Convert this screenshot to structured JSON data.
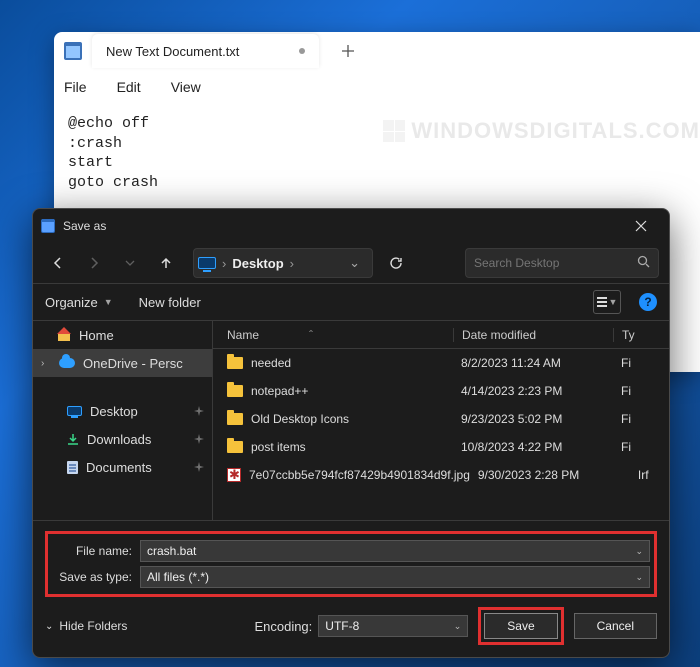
{
  "notepad": {
    "tab_title": "New Text Document.txt",
    "menu": {
      "file": "File",
      "edit": "Edit",
      "view": "View"
    },
    "content": "@echo off\n:crash\nstart\ngoto crash"
  },
  "watermark": "WINDOWSDIGITALS.COM",
  "dialog": {
    "title": "Save as",
    "breadcrumb": "Desktop",
    "search_placeholder": "Search Desktop",
    "organize": "Organize",
    "new_folder": "New folder",
    "help": "?",
    "sidebar": {
      "home": "Home",
      "onedrive": "OneDrive - Persc",
      "desktop": "Desktop",
      "downloads": "Downloads",
      "documents": "Documents"
    },
    "headers": {
      "name": "Name",
      "date": "Date modified",
      "type": "Ty"
    },
    "rows": [
      {
        "icon": "folder",
        "name": "needed",
        "date": "8/2/2023 11:24 AM",
        "type": "Fi"
      },
      {
        "icon": "folder",
        "name": "notepad++",
        "date": "4/14/2023 2:23 PM",
        "type": "Fi"
      },
      {
        "icon": "folder",
        "name": "Old Desktop Icons",
        "date": "9/23/2023 5:02 PM",
        "type": "Fi"
      },
      {
        "icon": "folder",
        "name": "post items",
        "date": "10/8/2023 4:22 PM",
        "type": "Fi"
      },
      {
        "icon": "jpg",
        "name": "7e07ccbb5e794fcf87429b4901834d9f.jpg",
        "date": "9/30/2023 2:28 PM",
        "type": "Irf"
      }
    ],
    "file_name_label": "File name:",
    "file_name_value": "crash.bat",
    "save_type_label": "Save as type:",
    "save_type_value": "All files  (*.*)",
    "encoding_label": "Encoding:",
    "encoding_value": "UTF-8",
    "hide_folders": "Hide Folders",
    "save": "Save",
    "cancel": "Cancel"
  }
}
